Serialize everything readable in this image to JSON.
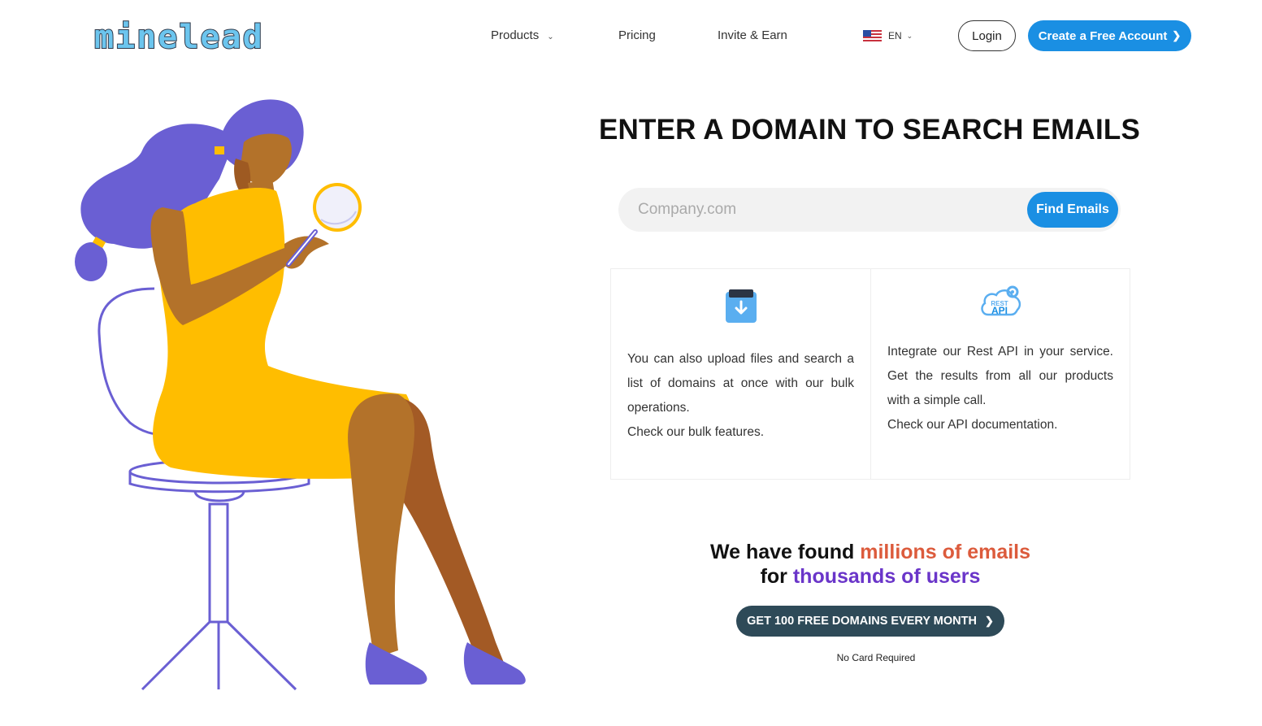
{
  "header": {
    "logo_text": "minelead",
    "nav": {
      "products": "Products",
      "pricing": "Pricing",
      "invite": "Invite & Earn"
    },
    "language": "EN",
    "login_label": "Login",
    "create_account_label": "Create a Free Account"
  },
  "main": {
    "title": "ENTER A DOMAIN TO SEARCH EMAILS",
    "search": {
      "placeholder": "Company.com",
      "button_label": "Find Emails"
    },
    "cards": [
      {
        "icon": "upload-box-icon",
        "text": "You can also upload files and search a list of domains at once with our bulk operations.",
        "link": "Check our bulk features."
      },
      {
        "icon": "rest-api-cloud-icon",
        "icon_text": "REST",
        "icon_text_2": "API",
        "text": "Integrate our Rest API in your service. Get the results from all our products with a simple call.",
        "link": "Check our API documentation."
      }
    ],
    "stats": {
      "part1": "We have found ",
      "highlight1": "millions of emails",
      "part2": "for ",
      "highlight2": "thousands of users"
    },
    "cta_label": "GET 100 FREE DOMAINS EVERY MONTH",
    "no_card": "No Card Required"
  },
  "colors": {
    "primary": "#1a8fe3",
    "dark_button": "#2e4a58",
    "orange": "#dc5b3c",
    "purple": "#6a35c9",
    "dress": "#ffbd00",
    "hair": "#6a5fd3"
  }
}
